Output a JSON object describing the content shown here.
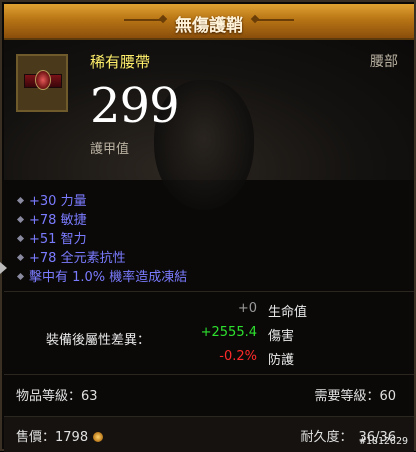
{
  "header": {
    "title": "無傷護鞘"
  },
  "item": {
    "name": "稀有腰帶",
    "slot": "腰部",
    "armor_value": "299",
    "armor_label": "護甲值"
  },
  "affixes": [
    "+30 力量",
    "+78 敏捷",
    "+51 智力",
    "+78 全元素抗性",
    "擊中有 1.0% 機率造成凍結"
  ],
  "comparison": {
    "title": "裝備後屬性差異：",
    "rows": [
      {
        "value": "+0",
        "label": "生命值",
        "color": "#9a9a9a"
      },
      {
        "value": "+2555.4",
        "label": "傷害",
        "color": "#2ee02e"
      },
      {
        "value": "-0.2%",
        "label": "防護",
        "color": "#ff2a2a"
      }
    ]
  },
  "footer": {
    "item_level": "物品等級：63",
    "required_level": "需要等級：60",
    "sell_price": "售價：1798",
    "durability_label": "耐久度：",
    "durability_value": "36/36",
    "watermark": "#1812629"
  },
  "colors": {
    "header": "#c2831f",
    "rare_name": "#ffef6b",
    "affix": "#7b7bff"
  },
  "icons": {
    "item": "belt-icon",
    "coin": "gold-coin-icon",
    "bullet": "diamond-bullet-icon"
  }
}
